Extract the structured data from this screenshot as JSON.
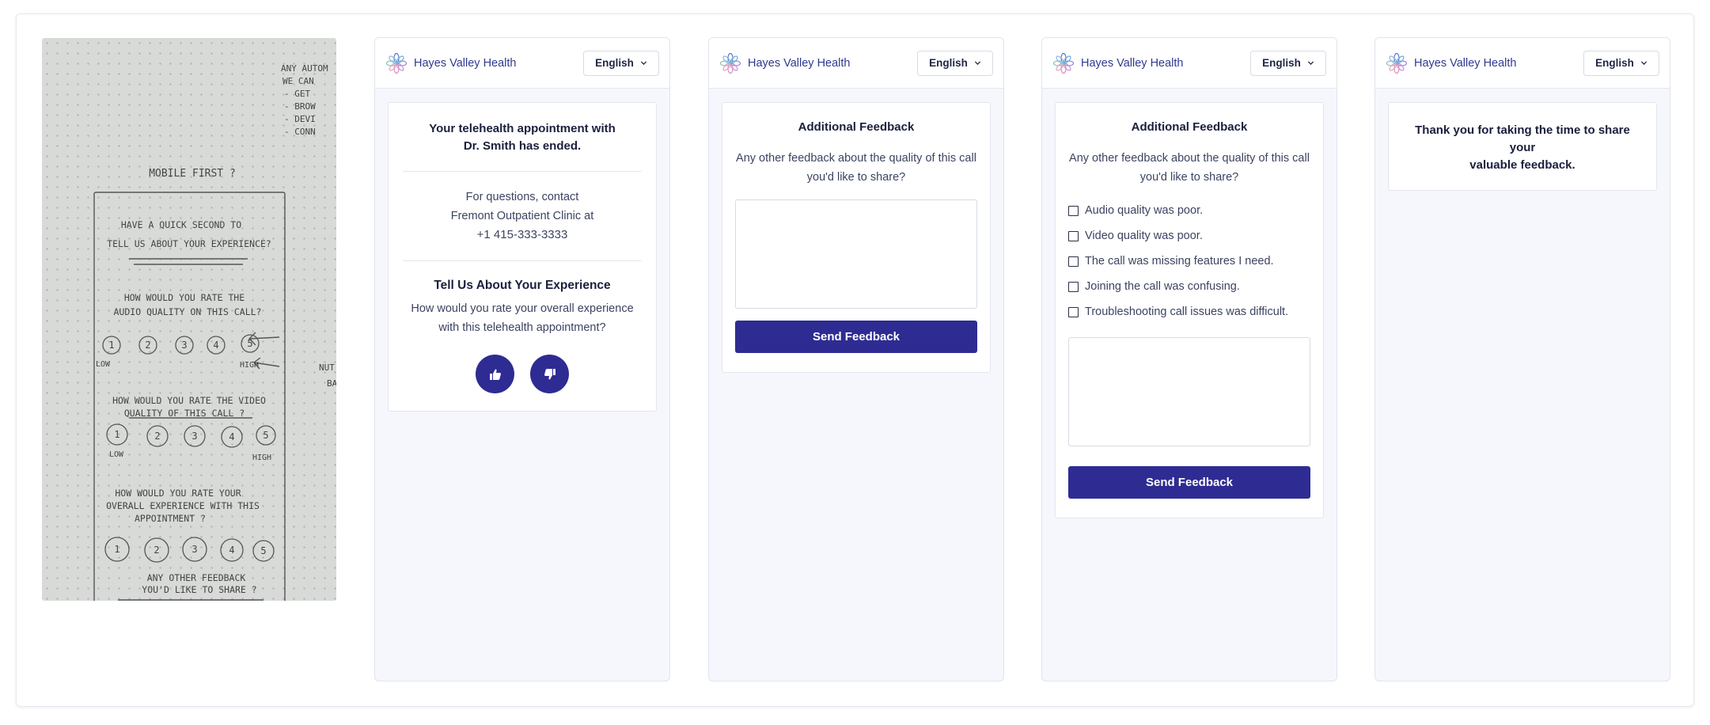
{
  "brand": {
    "name": "Hayes Valley Health",
    "accent": "#2e2c93",
    "brand_text_color": "#2f3a8f"
  },
  "language_selector": {
    "value": "English",
    "icon": "chevron-down-icon"
  },
  "sketch": {
    "lines": [
      "MOBILE FIRST ?",
      "HAVE A QUICK SECOND TO",
      "TELL US ABOUT YOUR EXPERIENCE?",
      "HOW WOULD YOU RATE THE",
      "AUDIO QUALITY ON THIS CALL?",
      "HOW WOULD YOU RATE THE VIDEO",
      "QUALITY OF THIS CALL ?",
      "HOW WOULD YOU RATE YOUR",
      "OVERALL EXPERIENCE WITH THIS",
      "APPOINTMENT ?",
      "ANY OTHER FEEDBACK",
      "YOU'D LIKE TO SHARE ?"
    ],
    "side_notes": [
      "ANY AUTOM",
      "WE CAN",
      "- GET",
      "- BROW",
      "- DEVI",
      "- CONN"
    ],
    "rating_numbers": [
      "1",
      "2",
      "3",
      "4",
      "5"
    ],
    "low_label": "LOW",
    "high_label": "HIGH",
    "margin_note": [
      "NUT",
      "BA"
    ]
  },
  "screen1": {
    "title_line1": "Your telehealth appointment with",
    "title_line2": "Dr. Smith has ended.",
    "contact_line1": "For questions, contact",
    "contact_line2": "Fremont Outpatient Clinic at",
    "phone": "+1 415-333-3333",
    "section_title": "Tell Us About Your Experience",
    "question_line1": "How would you rate your overall experience",
    "question_line2": "with this telehealth appointment?",
    "thumbs_up_icon": "thumbs-up-icon",
    "thumbs_down_icon": "thumbs-down-icon"
  },
  "screen2": {
    "title": "Additional Feedback",
    "question_line1": "Any other feedback about the quality of this call",
    "question_line2": "you'd like to share?",
    "textarea_placeholder": "",
    "send_label": "Send Feedback"
  },
  "screen3": {
    "title": "Additional Feedback",
    "question_line1": "Any other feedback about the quality of this call",
    "question_line2": "you'd like to share?",
    "options": [
      "Audio quality was poor.",
      "Video quality was poor.",
      "The call was missing features I need.",
      "Joining the call was confusing.",
      "Troubleshooting call issues was difficult."
    ],
    "textarea_placeholder": "",
    "send_label": "Send Feedback"
  },
  "screen4": {
    "message_line1": "Thank you for taking the time to share your",
    "message_line2": "valuable feedback."
  }
}
